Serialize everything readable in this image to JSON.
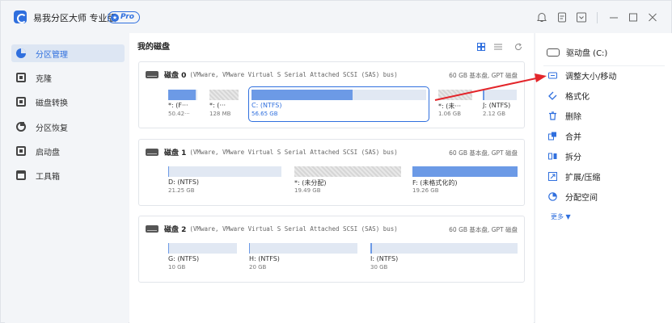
{
  "app": {
    "title": "易我分区大师 专业版",
    "pro_badge": "Pro"
  },
  "titlebar_icons": [
    "bell-icon",
    "document-icon",
    "dropdown-box-icon",
    "minimize-icon",
    "maximize-icon",
    "close-icon"
  ],
  "sidebar": {
    "items": [
      {
        "label": "分区管理",
        "icon": "partition-pie-icon",
        "active": true
      },
      {
        "label": "克隆",
        "icon": "clone-icon",
        "active": false
      },
      {
        "label": "磁盘转换",
        "icon": "disk-convert-icon",
        "active": false
      },
      {
        "label": "分区恢复",
        "icon": "partition-recovery-icon",
        "active": false
      },
      {
        "label": "启动盘",
        "icon": "boot-disk-icon",
        "active": false
      },
      {
        "label": "工具箱",
        "icon": "toolbox-icon",
        "active": false
      }
    ]
  },
  "main": {
    "title": "我的磁盘",
    "disks": [
      {
        "name": "磁盘 0",
        "desc": "(VMware, VMware Virtual S Serial Attached SCSI (SAS) bus)",
        "info": "60 GB 基本盘, GPT 磁盘",
        "partitions": [
          {
            "label": "*: (F···",
            "size": "50.42···",
            "fill": 0.95,
            "unallocated": false,
            "selected": false
          },
          {
            "label": "*: (···",
            "size": "128 MB",
            "fill": 0,
            "unallocated": true,
            "selected": false
          },
          {
            "label": "C: (NTFS)",
            "size": "56.65 GB",
            "fill": 0.58,
            "unallocated": false,
            "selected": true
          },
          {
            "label": "*: (未···",
            "size": "1.06 GB",
            "fill": 0,
            "unallocated": true,
            "selected": false
          },
          {
            "label": "J: (NTFS)",
            "size": "2.12 GB",
            "fill": 0.05,
            "unallocated": false,
            "selected": false
          }
        ]
      },
      {
        "name": "磁盘 1",
        "desc": "(VMware, VMware Virtual S Serial Attached SCSI (SAS) bus)",
        "info": "60 GB 基本盘, GPT 磁盘",
        "partitions": [
          {
            "label": "D: (NTFS)",
            "size": "21.25 GB",
            "fill": 0.01,
            "unallocated": false,
            "selected": false
          },
          {
            "label": "*: (未分配)",
            "size": "19.49 GB",
            "fill": 0,
            "unallocated": true,
            "selected": false
          },
          {
            "label": "F: (未格式化的)",
            "size": "19.26 GB",
            "fill": 1.0,
            "unallocated": false,
            "selected": false
          }
        ]
      },
      {
        "name": "磁盘 2",
        "desc": "(VMware, VMware Virtual S Serial Attached SCSI (SAS) bus)",
        "info": "60 GB 基本盘, GPT 磁盘",
        "partitions": [
          {
            "label": "G: (NTFS)",
            "size": "10 GB",
            "fill": 0.01,
            "unallocated": false,
            "selected": false
          },
          {
            "label": "H: (NTFS)",
            "size": "20 GB",
            "fill": 0.01,
            "unallocated": false,
            "selected": false
          },
          {
            "label": "I: (NTFS)",
            "size": "30 GB",
            "fill": 0.01,
            "unallocated": false,
            "selected": false
          }
        ]
      }
    ]
  },
  "right": {
    "drive": "驱动盘 (C:)",
    "operations": [
      {
        "label": "调整大小/移动",
        "icon": "resize-move-icon"
      },
      {
        "label": "格式化",
        "icon": "format-icon"
      },
      {
        "label": "删除",
        "icon": "delete-icon"
      },
      {
        "label": "合并",
        "icon": "merge-icon"
      },
      {
        "label": "拆分",
        "icon": "split-icon"
      },
      {
        "label": "扩展/压缩",
        "icon": "extend-shrink-icon"
      },
      {
        "label": "分配空间",
        "icon": "allocate-space-icon"
      }
    ],
    "more": "更多 ▼"
  },
  "colors": {
    "accent": "#2f6fde",
    "partition_fill": "#6c9ae6",
    "partition_bg": "#e1e8f3",
    "annotation_arrow": "#e3262b"
  }
}
